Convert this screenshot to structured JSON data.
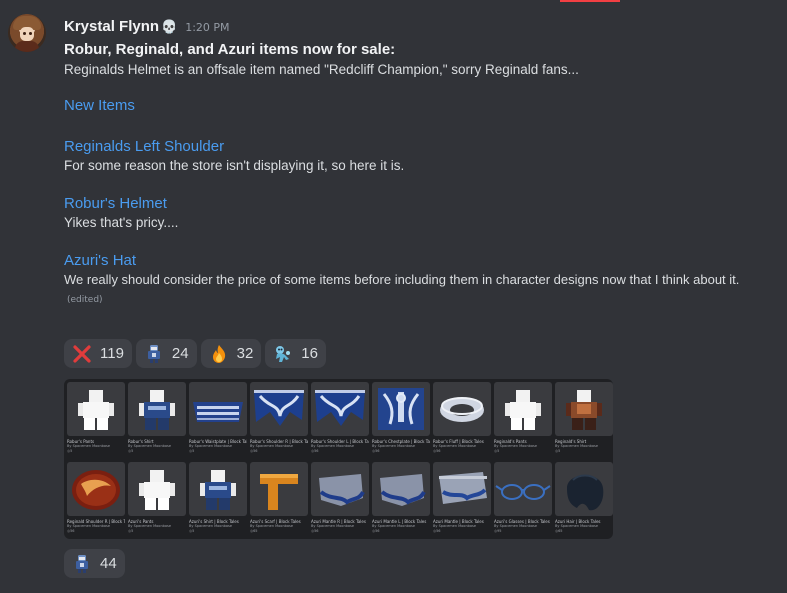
{
  "message": {
    "username": "Krystal Flynn",
    "badge_icon": "skull-icon",
    "timestamp": "1:20 PM",
    "title": "Robur, Reginald, and Azuri items now for sale:",
    "intro": "Reginalds Helmet is an offsale item named \"Redcliff Champion,\" sorry Reginald fans...",
    "links": [
      {
        "label": "New Items",
        "caption": ""
      },
      {
        "label": "Reginalds Left Shoulder",
        "caption": "For some reason the store isn't displaying it, so here it is."
      },
      {
        "label": "Robur's Helmet",
        "caption": "Yikes that's pricy...."
      },
      {
        "label": "Azuri's Hat",
        "caption": "We really should consider the price of some items before including them in character designs now that I think about it."
      }
    ],
    "edited": "(edited)"
  },
  "reactions": [
    {
      "icon": "cross-mark-icon",
      "count": "119"
    },
    {
      "icon": "custom-character-emoji-icon",
      "count": "24"
    },
    {
      "icon": "fire-icon",
      "count": "32"
    },
    {
      "icon": "custom-creature-emoji-icon",
      "count": "16"
    }
  ],
  "attachment_reaction": {
    "icon": "custom-character-emoji-icon",
    "count": "44"
  },
  "gallery": {
    "items": [
      {
        "name": "Robur's Pants",
        "by": "By Spacemen Moonbase",
        "price": "5",
        "kind": "figure-white"
      },
      {
        "name": "Robur's Shirt",
        "by": "By Spacemen Moonbase",
        "price": "5",
        "kind": "figure-blue"
      },
      {
        "name": "Robur's Waistplate | Block Tales",
        "by": "By Spacemen Moonbase",
        "price": "5",
        "kind": "belt"
      },
      {
        "name": "Robur's Shoulder R | Block Tales",
        "by": "By Spacemen Moonbase",
        "price": "56",
        "kind": "armor"
      },
      {
        "name": "Robur's Shoulder L | Block Tales",
        "by": "By Spacemen Moonbase",
        "price": "56",
        "kind": "armor"
      },
      {
        "name": "Robur's Chestplate | Block Tales",
        "by": "By Spacemen Moonbase",
        "price": "56",
        "kind": "chest"
      },
      {
        "name": "Robur's Fluff | Block Tales",
        "by": "By Spacemen Moonbase",
        "price": "56",
        "kind": "fluff"
      },
      {
        "name": "Reginald's Pants",
        "by": "By Spacemen Moonbase",
        "price": "5",
        "kind": "figure-white"
      },
      {
        "name": "Reginald's Shirt",
        "by": "By Spacemen Moonbase",
        "price": "5",
        "kind": "figure-brown"
      },
      {
        "name": "Reginald Shoulder R | Block Tales",
        "by": "By Spacemen Moonbase",
        "price": "56",
        "kind": "shield-red"
      },
      {
        "name": "Azuri's Pants",
        "by": "By Spacemen Moonbase",
        "price": "5",
        "kind": "figure-white"
      },
      {
        "name": "Azuri's Shirt | Block Tales",
        "by": "By Spacemen Moonbase",
        "price": "5",
        "kind": "figure-blue"
      },
      {
        "name": "Azuri's Scarf | Block Tales",
        "by": "By Spacemen Moonbase",
        "price": "65",
        "kind": "scarf"
      },
      {
        "name": "Azuri Mantle R | Block Tales",
        "by": "By Spacemen Moonbase",
        "price": "56",
        "kind": "mantle"
      },
      {
        "name": "Azuri Mantle L | Block Tales",
        "by": "By Spacemen Moonbase",
        "price": "56",
        "kind": "mantle"
      },
      {
        "name": "Azuri Mantle | Block Tales",
        "by": "By Spacemen Moonbase",
        "price": "56",
        "kind": "hat-flat"
      },
      {
        "name": "Azuri's Glasses | Block Tales",
        "by": "By Spacemen Moonbase",
        "price": "95",
        "kind": "glasses"
      },
      {
        "name": "Azuri Hair | Block Tales",
        "by": "By Spacemen Moonbase",
        "price": "65",
        "kind": "hair"
      }
    ]
  },
  "colors": {
    "background": "#313338",
    "link": "#4a9cf0",
    "reaction_bg": "#3f4147",
    "cross_red": "#e03c3c"
  }
}
